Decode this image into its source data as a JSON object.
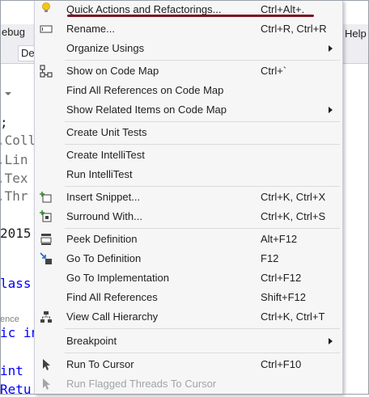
{
  "background": {
    "menu_left_fragment": "ebug",
    "menu_right_fragment": "Help",
    "combo_text": "De",
    "code_fragments": [
      ";",
      ".Coll",
      ".Lin",
      ".Tex",
      ".Thr",
      "2015",
      "lass",
      "ic in",
      "int",
      "Retu"
    ],
    "reference_hint": "ence"
  },
  "context_menu": {
    "items": [
      {
        "label": "Quick Actions and Refactorings...",
        "shortcut": "Ctrl+Alt+.",
        "icon": "lightbulb-icon"
      },
      {
        "label": "Rename...",
        "shortcut": "Ctrl+R, Ctrl+R",
        "icon": "rename-icon"
      },
      {
        "label": "Organize Usings",
        "shortcut": "",
        "icon": "",
        "submenu": true
      },
      {
        "label": "Show on Code Map",
        "shortcut": "Ctrl+`",
        "icon": "code-map-icon"
      },
      {
        "label": "Find All References on Code Map",
        "shortcut": "",
        "icon": ""
      },
      {
        "label": "Show Related Items on Code Map",
        "shortcut": "",
        "icon": "",
        "submenu": true
      },
      {
        "label": "Create Unit Tests",
        "shortcut": "",
        "icon": ""
      },
      {
        "label": "Create IntelliTest",
        "shortcut": "",
        "icon": ""
      },
      {
        "label": "Run IntelliTest",
        "shortcut": "",
        "icon": ""
      },
      {
        "label": "Insert Snippet...",
        "shortcut": "Ctrl+K, Ctrl+X",
        "icon": "snippet-icon"
      },
      {
        "label": "Surround With...",
        "shortcut": "Ctrl+K, Ctrl+S",
        "icon": "surround-icon"
      },
      {
        "label": "Peek Definition",
        "shortcut": "Alt+F12",
        "icon": "peek-definition-icon"
      },
      {
        "label": "Go To Definition",
        "shortcut": "F12",
        "icon": "go-to-definition-icon"
      },
      {
        "label": "Go To Implementation",
        "shortcut": "Ctrl+F12",
        "icon": ""
      },
      {
        "label": "Find All References",
        "shortcut": "Shift+F12",
        "icon": ""
      },
      {
        "label": "View Call Hierarchy",
        "shortcut": "Ctrl+K, Ctrl+T",
        "icon": "call-hierarchy-icon"
      },
      {
        "label": "Breakpoint",
        "shortcut": "",
        "icon": "",
        "submenu": true
      },
      {
        "label": "Run To Cursor",
        "shortcut": "Ctrl+F10",
        "icon": "run-to-cursor-icon"
      },
      {
        "label": "Run Flagged Threads To Cursor",
        "shortcut": "",
        "icon": "run-flagged-threads-icon",
        "disabled": true
      }
    ]
  },
  "colors": {
    "menu_background": "#f6f6f6",
    "highlight_underline": "#7a1424",
    "separator": "#dadbe0",
    "text": "#1e1e1e",
    "disabled_text": "#a2a4a5",
    "keyword_blue": "#0000ff"
  }
}
